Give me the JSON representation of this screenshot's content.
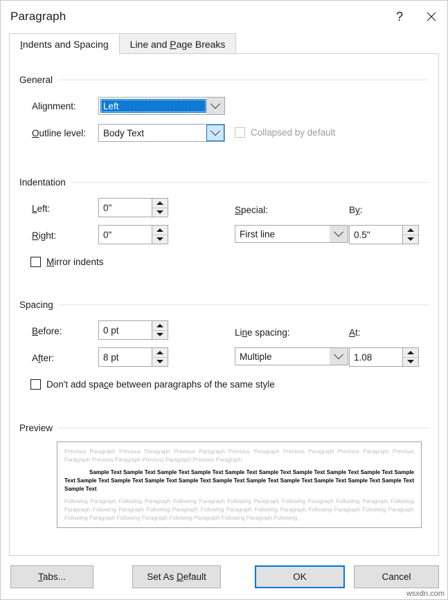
{
  "window": {
    "title": "Paragraph",
    "help_icon": "question-mark-icon",
    "close_icon": "close-x-icon"
  },
  "tabs": [
    {
      "label": "Indents and Spacing",
      "accel": "I",
      "active": true
    },
    {
      "label": "Line and Page Breaks",
      "accel": "P",
      "active": false
    }
  ],
  "general": {
    "heading": "General",
    "alignment": {
      "label": "Alignment:",
      "value": "Left",
      "state": "focused-selected"
    },
    "outline_level": {
      "label": "Outline level:",
      "label_accel": "O",
      "value": "Body Text",
      "state": "hover"
    },
    "collapsed_by_default": {
      "label": "Collapsed by default",
      "checked": false,
      "disabled": true
    }
  },
  "indentation": {
    "heading": "Indentation",
    "left": {
      "label": "Left:",
      "label_accel": "L",
      "value": "0\""
    },
    "right": {
      "label": "Right:",
      "label_accel": "R",
      "value": "0\""
    },
    "mirror_indents": {
      "label": "Mirror indents",
      "accel": "M",
      "checked": false
    },
    "special": {
      "label": "Special:",
      "label_accel": "S",
      "value": "First line"
    },
    "by": {
      "label": "By:",
      "label_accel": "y",
      "value": "0.5\""
    }
  },
  "spacing": {
    "heading": "Spacing",
    "before": {
      "label": "Before:",
      "label_accel": "B",
      "value": "0 pt"
    },
    "after": {
      "label": "After:",
      "label_accel": "f",
      "value": "8 pt"
    },
    "dont_add_space": {
      "label_a": "Don't add spa",
      "label_accel": "c",
      "label_b": "e between paragraphs of the same style",
      "checked": false
    },
    "line_spacing": {
      "label": "Line spacing:",
      "label_accel": "n",
      "value": "Multiple"
    },
    "at": {
      "label": "At:",
      "label_accel": "A",
      "value": "1.08"
    }
  },
  "preview": {
    "heading": "Preview",
    "previous_text": "Previous Paragraph Previous Paragraph Previous Paragraph Previous Paragraph Previous Paragraph Previous Paragraph Previous Paragraph Previous Paragraph Previous Paragraph Previous Paragraph",
    "sample_text": "Sample Text Sample Text Sample Text Sample Text Sample Text Sample Text Sample Text Sample Text Sample Text Sample Text Sample Text Sample Text Sample Text Sample Text Sample Text Sample Text Sample Text Sample Text Sample Text Sample Text Sample Text",
    "following_text": "Following Paragraph Following Paragraph Following Paragraph Following Paragraph Following Paragraph Following Paragraph Following Paragraph Following Paragraph Following Paragraph Following Paragraph Following Paragraph Following Paragraph Following Paragraph Following Paragraph Following Paragraph Following Paragraph Following Paragraph Following"
  },
  "footer": {
    "tabs_button": "Tabs...",
    "tabs_accel": "T",
    "set_as_default_button": "Set As Default",
    "set_as_default_accel": "D",
    "ok_button": "OK",
    "cancel_button": "Cancel"
  },
  "watermark": "wsxdn.com",
  "colors": {
    "accent": "#0078d7",
    "selection": "#0f7ad4",
    "hover": "#cce8ff",
    "button_face": "#e1e1e1",
    "preview_gray": "#c0c0c0"
  }
}
